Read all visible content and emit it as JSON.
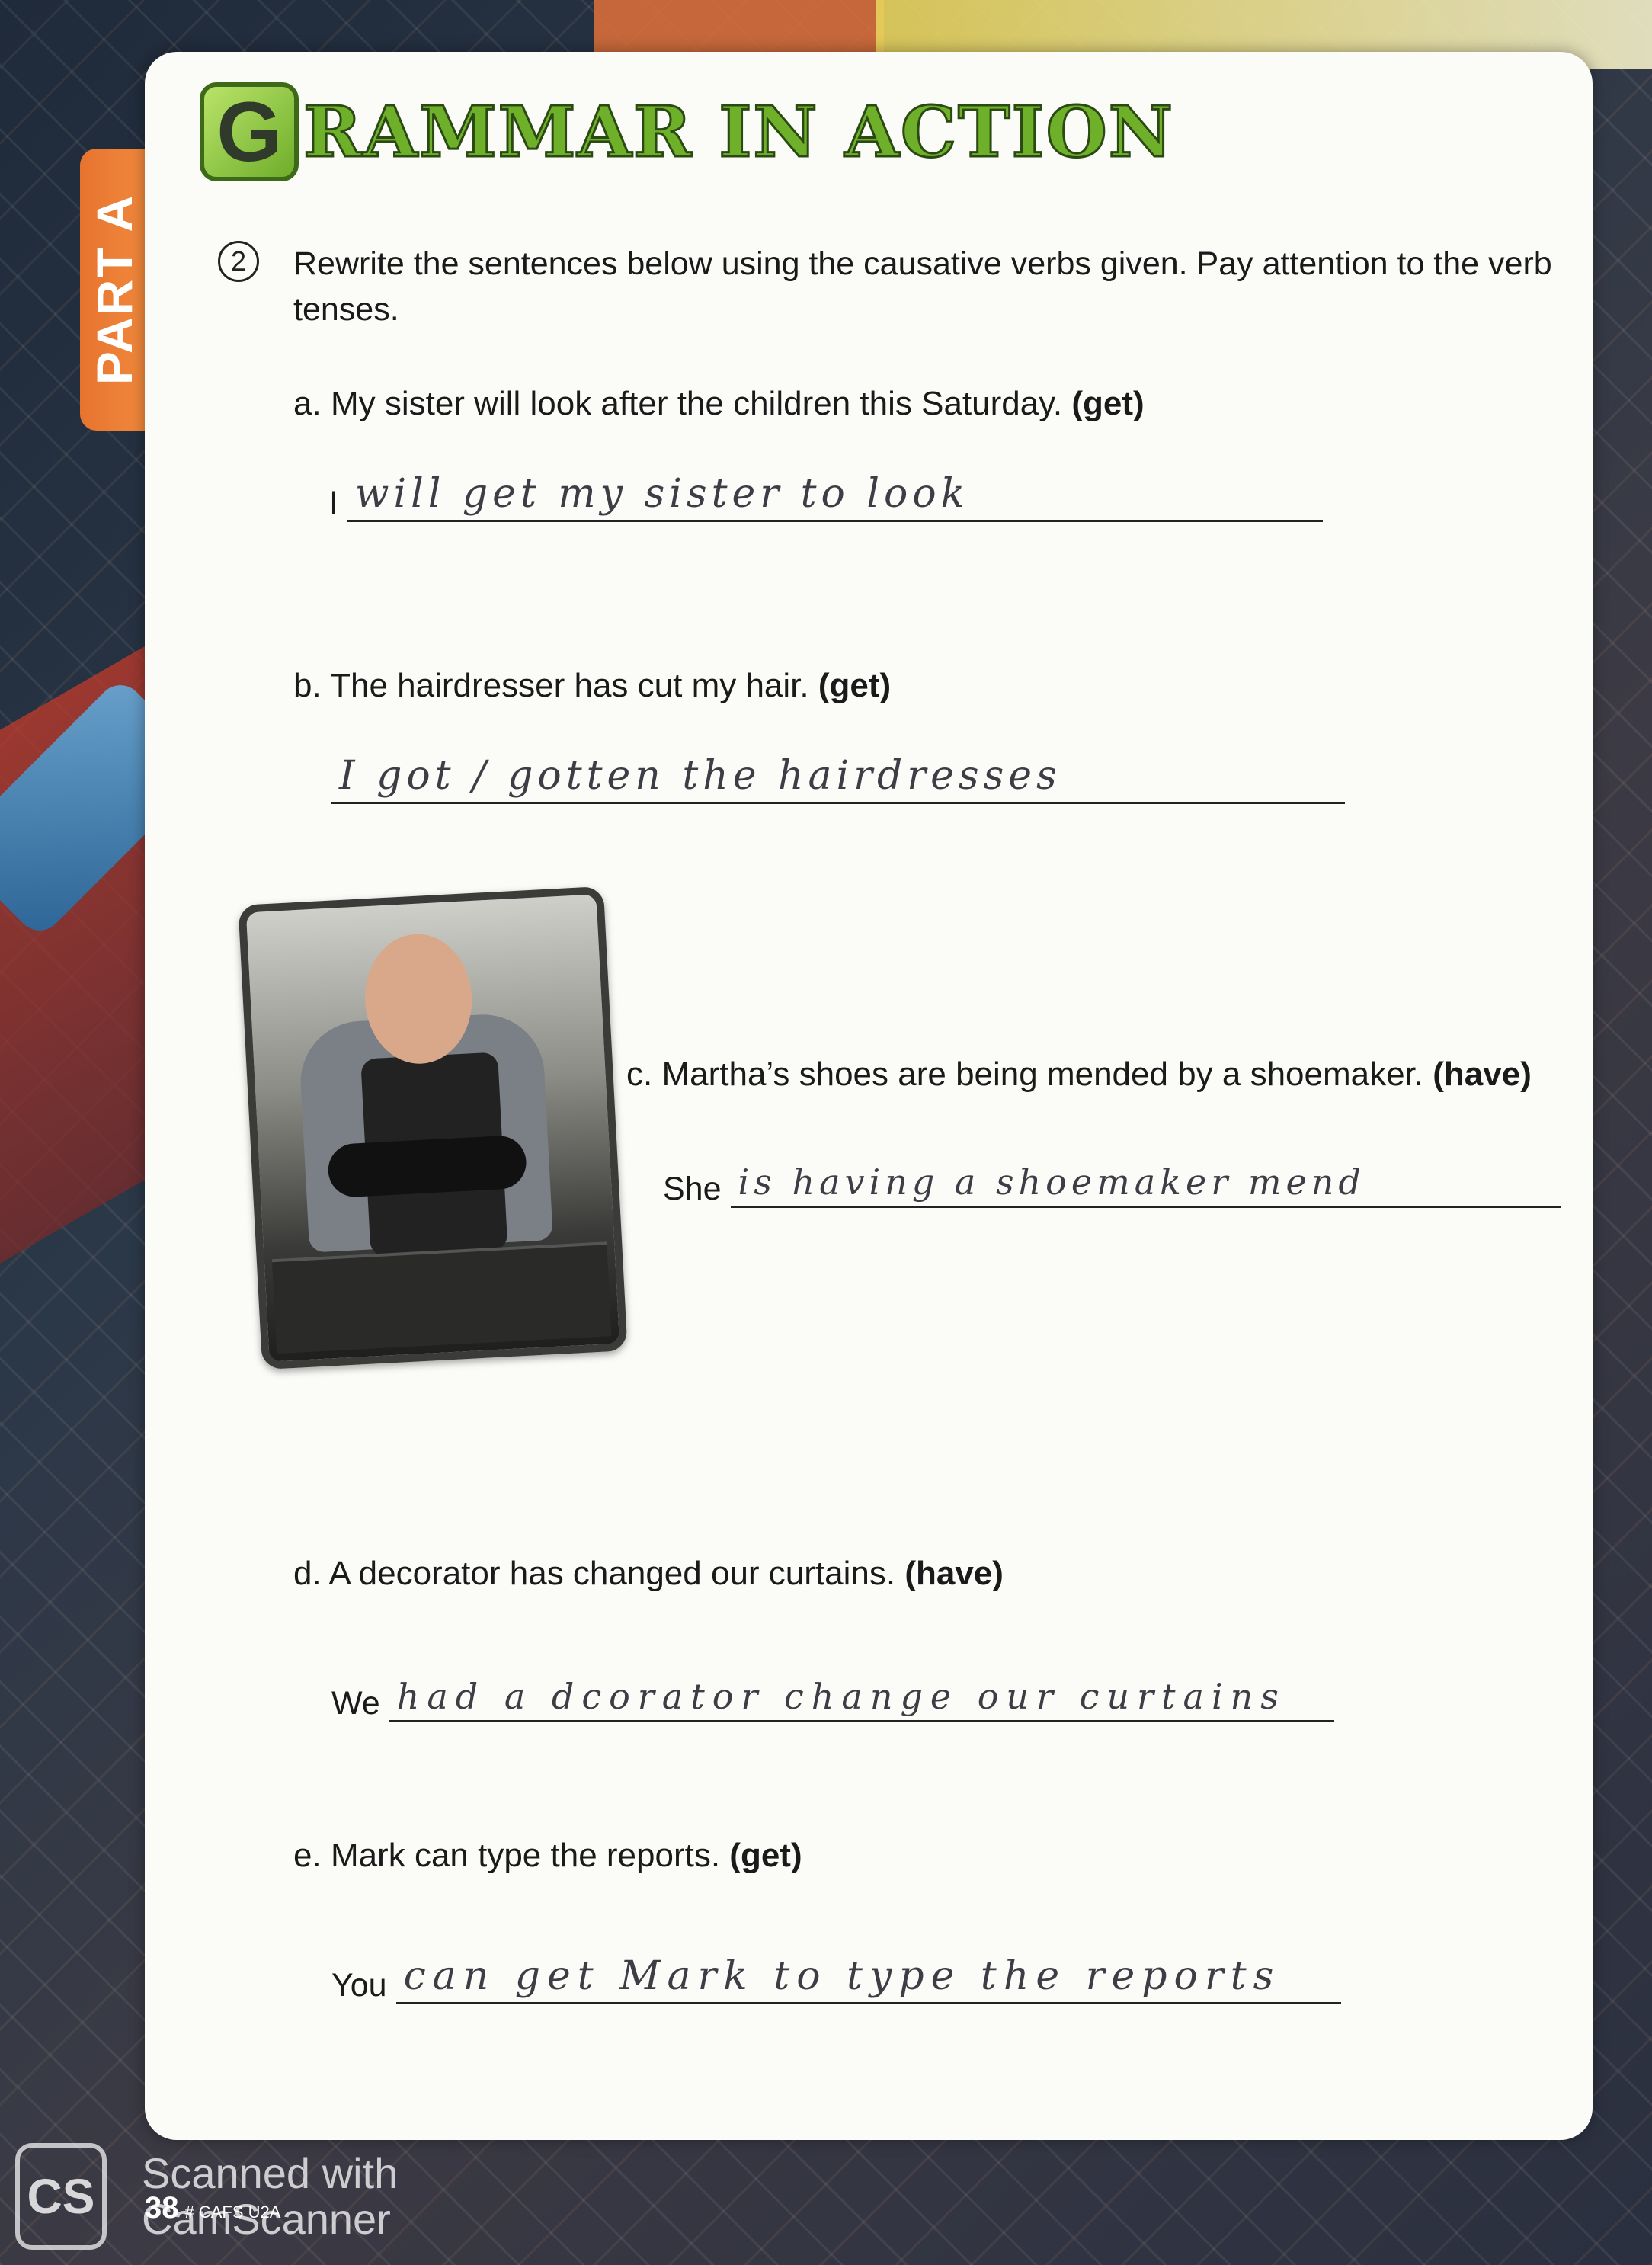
{
  "tab": "PART A",
  "title": {
    "initial": "G",
    "rest": "RAMMAR IN ACTION"
  },
  "exercise": {
    "number": "2",
    "instruction": "Rewrite the sentences below using the causative verbs given. Pay attention to the verb tenses."
  },
  "questions": [
    {
      "label": "a.",
      "text": "My sister will look after the children this Saturday.",
      "verb": "(get)",
      "prefix": "I",
      "answer": "will get my sister to look"
    },
    {
      "label": "b.",
      "text": "The hairdresser has cut my hair.",
      "verb": "(get)",
      "prefix": "",
      "answer": "I got / gotten the hairdresses"
    },
    {
      "label": "c.",
      "text": "Martha’s shoes are being mended by a shoemaker.",
      "verb": "(have)",
      "prefix": "She",
      "answer": "is having a shoemaker mend"
    },
    {
      "label": "d.",
      "text": "A decorator has changed our curtains.",
      "verb": "(have)",
      "prefix": "We",
      "answer": "had a dcorator change our curtains"
    },
    {
      "label": "e.",
      "text": "Mark can type the reports.",
      "verb": "(get)",
      "prefix": "You",
      "answer": "can get Mark to type the reports"
    }
  ],
  "footer": {
    "logo": "CS",
    "scanner_line1": "Scanned with",
    "scanner_line2": "CamScanner",
    "page_number": "38",
    "code": "# CAFS U2A"
  }
}
